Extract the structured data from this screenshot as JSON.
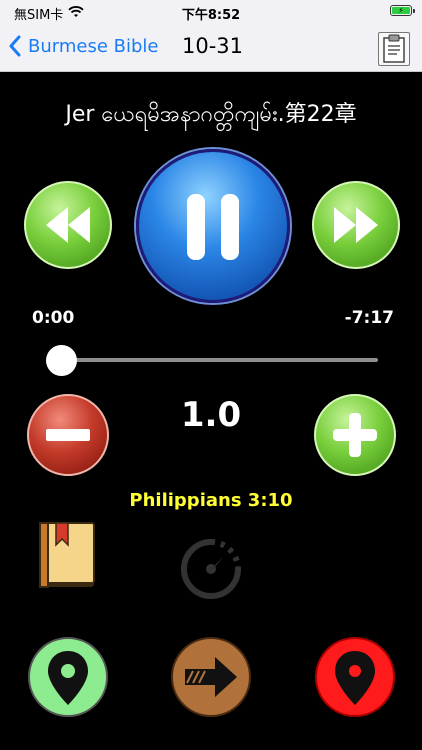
{
  "status_bar": {
    "carrier": "無SIM卡",
    "time": "下午8:52",
    "wifi_icon": "wifi-icon",
    "battery_icon": "battery-charging-icon"
  },
  "nav": {
    "back_label": "Burmese Bible",
    "title": "10-31",
    "clipboard_icon": "clipboard-icon"
  },
  "player": {
    "chapter_title": "Jer ယေရမိအနာဂတ္တိကျမ်း.第22章",
    "elapsed": "0:00",
    "remaining": "-7:17",
    "progress": 0,
    "speed": "1.0"
  },
  "verse": "Philippians 3:10",
  "icons": {
    "rewind": "rewind-icon",
    "pause": "pause-icon",
    "fast_forward": "fast-forward-icon",
    "minus": "minus-icon",
    "plus": "plus-icon",
    "book": "book-icon",
    "timer": "timer-icon",
    "pin_green": "green-location-pin-icon",
    "arrow": "arrow-right-icon",
    "pin_red": "red-location-pin-icon"
  }
}
